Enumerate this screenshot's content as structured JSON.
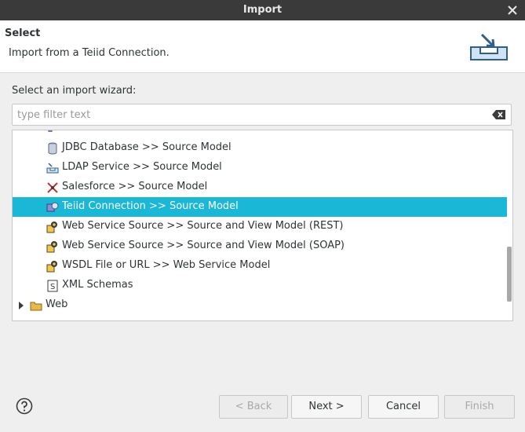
{
  "window": {
    "title": "Import"
  },
  "header": {
    "title": "Select",
    "description": "Import from a Teiid Connection."
  },
  "wizard_prompt": "Select an import wizard:",
  "filter": {
    "placeholder": "type filter text",
    "value": ""
  },
  "tree": {
    "items": [
      {
        "label": "JDBC Database >> Source Model",
        "icon": "database-icon",
        "selected": false
      },
      {
        "label": "LDAP Service >> Source Model",
        "icon": "ldap-icon",
        "selected": false
      },
      {
        "label": "Salesforce >> Source Model",
        "icon": "salesforce-icon",
        "selected": false
      },
      {
        "label": "Teiid Connection >> Source Model",
        "icon": "teiid-icon",
        "selected": true
      },
      {
        "label": "Web Service Source >> Source and View Model (REST)",
        "icon": "web-service-icon",
        "selected": false
      },
      {
        "label": "Web Service Source >> Source and View Model (SOAP)",
        "icon": "web-service-icon",
        "selected": false
      },
      {
        "label": "WSDL File or URL >> Web Service Model",
        "icon": "web-service-icon",
        "selected": false
      },
      {
        "label": "XML Schemas",
        "icon": "xml-schema-icon",
        "selected": false
      }
    ],
    "folder": {
      "label": "Web",
      "icon": "folder-icon",
      "expanded": false
    }
  },
  "buttons": {
    "back": "< Back",
    "next": "Next >",
    "cancel": "Cancel",
    "finish": "Finish"
  },
  "colors": {
    "selection": "#1ab8d6",
    "titlebar": "#3a3a3a"
  }
}
